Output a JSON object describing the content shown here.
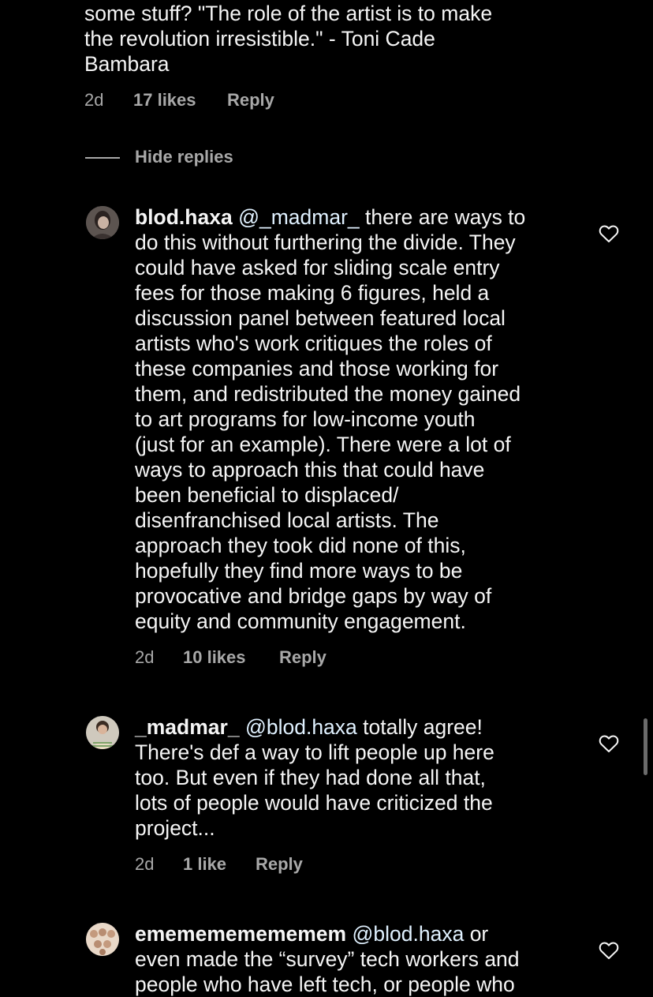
{
  "top_comment": {
    "text_lines": [
      "some stuff? \"The role of the artist is to make",
      "the revolution irresistible.\" - Toni Cade",
      "Bambara"
    ],
    "time": "2d",
    "likes": "17 likes",
    "reply_label": "Reply"
  },
  "hide_replies_label": "Hide replies",
  "replies": [
    {
      "username": "blod.haxa",
      "mention": "@_madmar_",
      "first_line_rest": " there are ways to",
      "lines": [
        "do this without furthering the divide. They",
        "could have asked for sliding scale entry",
        "fees for those making 6 figures, held a",
        "discussion panel between featured local",
        "artists who's work critiques the roles of",
        "these companies and those working for",
        "them, and redistributed the money gained",
        "to art programs for low-income youth",
        "(just for an example). There were a lot of",
        "ways to approach this that could have",
        "been beneficial to displaced/",
        "disenfranchised local artists. The",
        "approach they took did none of this,",
        "hopefully they find more ways to be",
        "provocative and bridge gaps by way of",
        "equity and community engagement."
      ],
      "time": "2d",
      "likes": "10 likes",
      "reply_label": "Reply",
      "avatar_icon": "avatar-photo-icon",
      "heart_icon": "heart-outline-icon"
    },
    {
      "username": "_madmar_",
      "mention": "@blod.haxa",
      "first_line_rest": " totally agree!",
      "lines": [
        "There's def a way to lift people up here",
        "too.  But even if they had done all that,",
        "lots of people would have criticized the",
        "project..."
      ],
      "time": "2d",
      "likes": "1 like",
      "reply_label": "Reply",
      "avatar_icon": "avatar-photo-icon",
      "heart_icon": "heart-outline-icon"
    },
    {
      "username": "ememememememem",
      "mention": "@blod.haxa",
      "first_line_rest": " or",
      "lines": [
        "even made the “survey” tech workers and",
        "people who have left tech, or people who"
      ],
      "avatar_icon": "avatar-photo-icon",
      "heart_icon": "heart-outline-icon"
    }
  ],
  "colors": {
    "background": "#000000",
    "text": "#f5f5f5",
    "meta": "#a8a8a8",
    "mention": "#e0f1ff"
  }
}
